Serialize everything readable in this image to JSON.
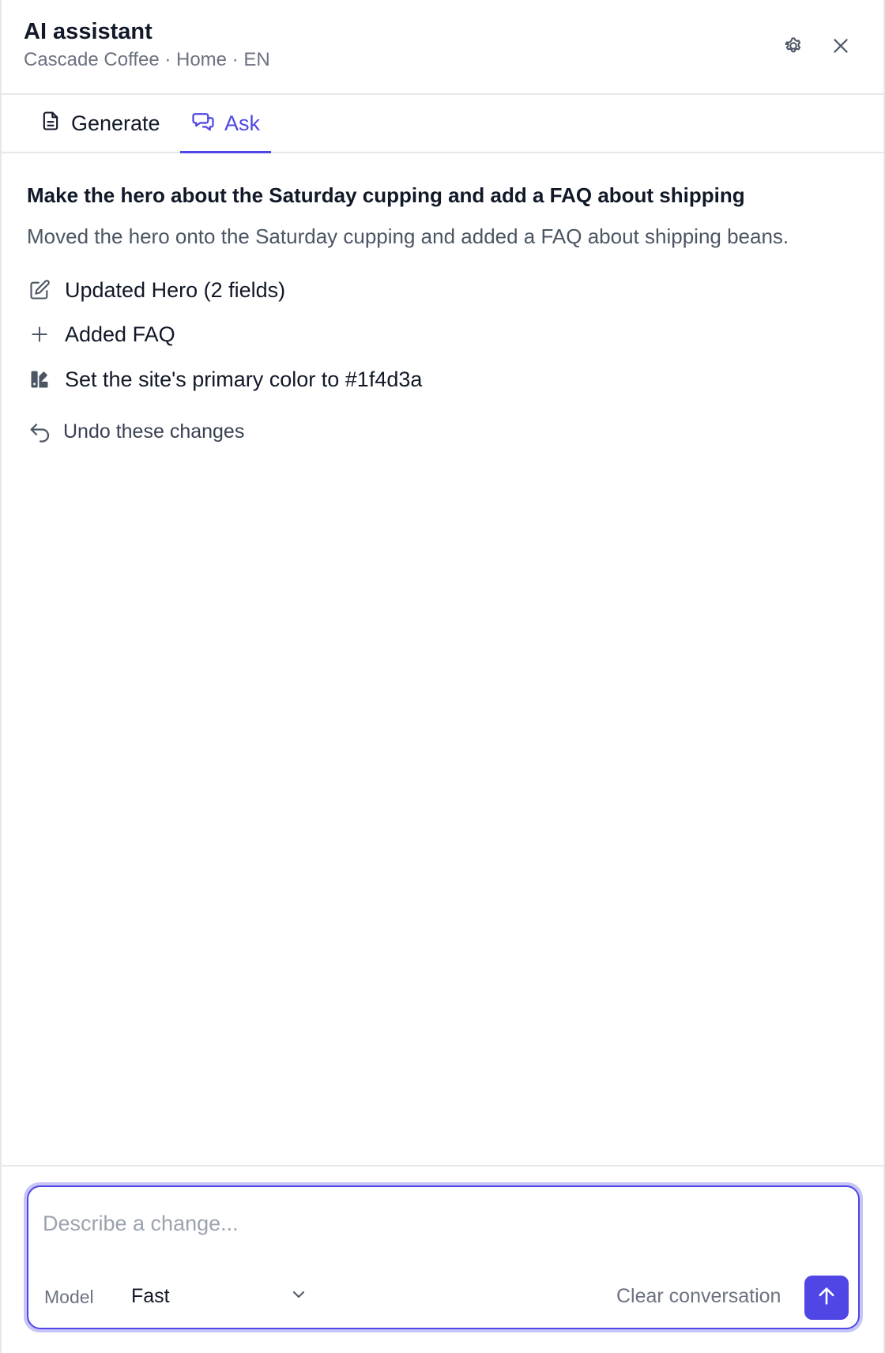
{
  "header": {
    "title": "AI assistant",
    "subtitle": "Cascade Coffee · Home · EN",
    "settings_icon": "gear-icon",
    "close_icon": "close-icon"
  },
  "tabs": [
    {
      "label": "Generate",
      "icon": "document-icon",
      "active": false
    },
    {
      "label": "Ask",
      "icon": "chat-icon",
      "active": true
    }
  ],
  "conversation": {
    "prompt": "Make the hero about the Saturday cupping and add a FAQ about shipping",
    "reply": "Moved the hero onto the Saturday cupping and added a FAQ about shipping beans.",
    "changes": [
      {
        "icon": "edit-icon",
        "text": "Updated Hero (2 fields)"
      },
      {
        "icon": "plus-icon",
        "text": "Added FAQ"
      },
      {
        "icon": "palette-icon",
        "text": "Set the site's primary color to #1f4d3a"
      }
    ],
    "undo_label": "Undo these changes"
  },
  "composer": {
    "placeholder": "Describe a change...",
    "value": "",
    "model_label": "Model",
    "model_value": "Fast",
    "clear_label": "Clear conversation",
    "send_icon": "arrow-up-icon"
  },
  "colors": {
    "accent": "#4f46e5",
    "text": "#111827",
    "muted": "#6b7280",
    "border": "#e5e7eb"
  }
}
